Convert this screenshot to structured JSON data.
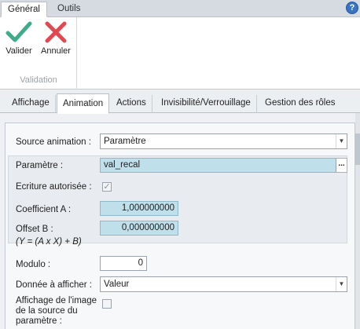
{
  "ribbon": {
    "tabs": [
      {
        "label": "Général",
        "active": true
      },
      {
        "label": "Outils",
        "active": false
      }
    ],
    "help_label": "?",
    "buttons": {
      "validate_label": "Valider",
      "cancel_label": "Annuler"
    },
    "group_label": "Validation",
    "colors": {
      "validate": "#3dac8a",
      "cancel": "#e2484f"
    }
  },
  "tabs": [
    {
      "label": "Affichage",
      "active": false
    },
    {
      "label": "Animation",
      "active": true
    },
    {
      "label": "Actions",
      "active": false
    },
    {
      "label": "Invisibilité/Verrouillage",
      "active": false
    },
    {
      "label": "Gestion des rôles",
      "active": false
    }
  ],
  "form": {
    "source_animation": {
      "label": "Source animation :",
      "value": "Paramètre"
    },
    "parametre": {
      "label": "Paramètre :",
      "value": "val_recal",
      "browse_label": "..."
    },
    "ecriture": {
      "label": "Ecriture autorisée :",
      "checked": true
    },
    "coef_a": {
      "label": "Coefficient A :",
      "value": "1,000000000"
    },
    "offset_b": {
      "label": "Offset B :",
      "value": "0,000000000",
      "formula": "(Y = (A x X) + B)"
    },
    "modulo": {
      "label": "Modulo :",
      "value": "0"
    },
    "donnee": {
      "label": "Donnée à afficher :",
      "value": "Valeur"
    },
    "affichage_image": {
      "label_lines": [
        "Affichage de l'image",
        "de la source du",
        "paramètre :"
      ],
      "checked": false
    }
  }
}
